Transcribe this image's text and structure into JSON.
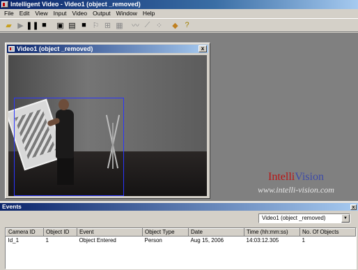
{
  "app": {
    "title": "Intelligent Video - Video1 (object _removed)"
  },
  "menu": [
    "File",
    "Edit",
    "View",
    "Input",
    "Video",
    "Output",
    "Window",
    "Help"
  ],
  "toolbar": {
    "icons": [
      "open-folder-icon",
      "play-icon",
      "pause-icon",
      "stop-icon",
      "frame-icon",
      "frame-filled-icon",
      "black-frame-icon",
      "flag-icon",
      "settings-icon",
      "snapshot-icon",
      "draw-line-icon",
      "draw-polyline-icon",
      "draw-points-icon",
      "tag-icon",
      "help-icon"
    ]
  },
  "video_window": {
    "title": "Video1 (object _removed)",
    "close_label": "x"
  },
  "brand": {
    "intelli": "Intelli",
    "vision": "Vision",
    "url": "www.intelli-vision.com"
  },
  "events": {
    "title": "Events",
    "close_label": "x",
    "source_select": {
      "selected": "Video1 (object _removed)"
    },
    "columns": [
      "Camera ID",
      "Object ID",
      "Event",
      "Object Type",
      "Date",
      "Time (hh:mm:ss)",
      "No. Of Objects"
    ],
    "rows": [
      [
        "Id_1",
        "1",
        "Object Entered",
        "Person",
        "Aug 15, 2006",
        "14:03:12.305",
        "1"
      ]
    ]
  },
  "colors": {
    "title_bar": "#0a246a",
    "bounding_box": "#2a35ff",
    "brand_red": "#b81414",
    "brand_blue": "#3c4aa8"
  }
}
